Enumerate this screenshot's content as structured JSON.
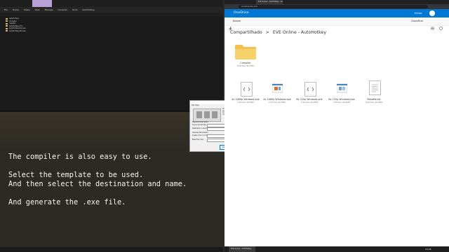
{
  "explorer": {
    "ribbon_items": [
      "File",
      "Home",
      "Share",
      "View",
      "Manage",
      "Compiler",
      "Tools",
      "AutoHotkey"
    ],
    "rows": [
      "AutoHotkey",
      "Compiler",
      "Installer",
      "AutoHotkey.chm",
      "AutoHotkeyA32.exe",
      "AutoHotkeyU32.exe",
      "AutoHotkeyU64.exe",
      "Installer.ahk",
      "license.txt",
      "WindowSpy.ahk"
    ]
  },
  "caption": {
    "line1": "The compiler is also easy to use.",
    "line2": "",
    "line3": "Select the template to be used.",
    "line4": "And then select the destination and name.",
    "line5": "",
    "line6": "And generate the .exe file."
  },
  "compiler_dialog": {
    "title": "Ahk2Exe for AutoHotkey",
    "menu": "File   Help",
    "info_lines": [
      "Ahk2Exe for AutoHotkey",
      "Compile AHK scripts to EXE",
      "ahkscript.org",
      "Original version by fincs"
    ],
    "labels": [
      "Required Parameters",
      "Source (script file)",
      "Destination (.exe file)",
      "Optional Parameters",
      "Custom Icon (.ico file)",
      "Base File (.bin)"
    ],
    "browse_label": "Browse",
    "convert_label": "Convert"
  },
  "browser": {
    "tab_title": "EVE Online - AutoHotkey - OneDrive",
    "url": "onedrive.live.com"
  },
  "onedrive": {
    "app_title": "OneDrive",
    "user_label": "Entrar",
    "back_label": "Baixar",
    "sort_label": "Classificar",
    "breadcrumb_root": "Compartilhado",
    "breadcrumb_sep": ">",
    "breadcrumb_current": "EVE Online - AutoHotkey",
    "folder": {
      "name": "Compiler",
      "date": "9 de mar. de 2019"
    },
    "files": [
      {
        "name": "4x 1080p Windows.ahk",
        "date": "2 de mar. de 2019"
      },
      {
        "name": "4x 1080p Windows.exe",
        "date": "2 de mar. de 2019"
      },
      {
        "name": "6x 720p Windows.ahk",
        "date": "2 de mar. de 2019"
      },
      {
        "name": "6x 720p Windows.exe",
        "date": "2 de mar. de 2019"
      },
      {
        "name": "ReadMe.txt",
        "date": "9 de mar. de 2019"
      }
    ]
  },
  "taskbar": {
    "item": "EVE Online - AutoHotkey",
    "time": "13:45"
  },
  "colors": {
    "onedrive_blue": "#0078d4",
    "folder_yellow": "#f4c04f"
  }
}
